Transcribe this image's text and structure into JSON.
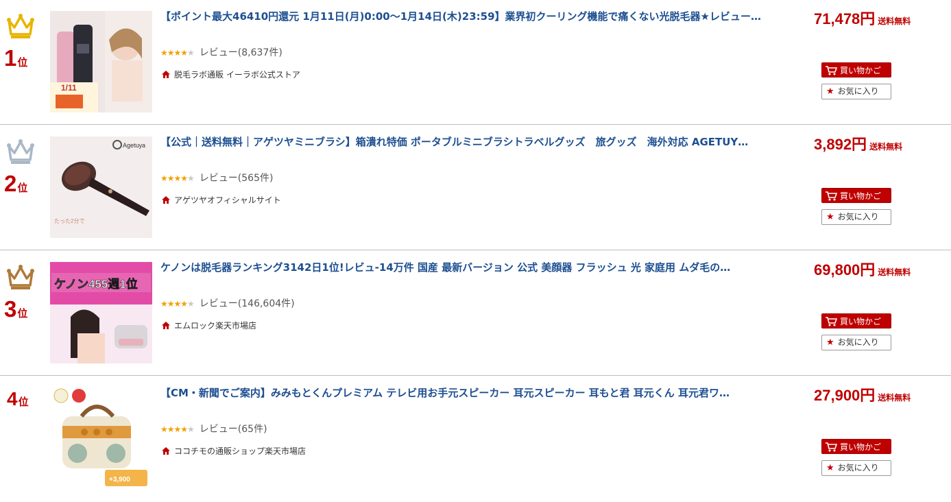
{
  "ranking": [
    {
      "rank_number": "1",
      "rank_suffix": "位",
      "crown": "gold-crown-icon",
      "title": "【ポイント最大46410円還元 1月11日(月)0:00～1月14日(木)23:59】業界初クーリング機能で痛くない光脱毛器★レビュー…",
      "rating_stars": 4,
      "review_text": "レビュー(8,637件)",
      "shop": "脱毛ラボ通販 イーラボ公式ストア",
      "price": "71,478円",
      "shipping": "送料無料",
      "cart_label": "買い物かご",
      "fav_label": "お気に入り",
      "thumb_text": "1/11"
    },
    {
      "rank_number": "2",
      "rank_suffix": "位",
      "crown": "silver-crown-icon",
      "title": "【公式｜送料無料｜アゲツヤミニブラシ】箱潰れ特価 ポータブルミニブラシトラベルグッズ　旅グッズ　海外対応 AGETUY…",
      "rating_stars": 4,
      "review_text": "レビュー(565件)",
      "shop": "アゲツヤオフィシャルサイト",
      "price": "3,892円",
      "shipping": "送料無料",
      "cart_label": "買い物かご",
      "fav_label": "お気に入り",
      "thumb_text": "Agetuya"
    },
    {
      "rank_number": "3",
      "rank_suffix": "位",
      "crown": "bronze-crown-icon",
      "title": "ケノンは脱毛器ランキング3142日1位!レビュ-14万件 国産 最新バージョン 公式 美顔器 フラッシュ 光 家庭用 ムダ毛の…",
      "rating_stars": 4,
      "review_text": "レビュー(146,604件)",
      "shop": "エムロック楽天市場店",
      "price": "69,800円",
      "shipping": "送料無料",
      "cart_label": "買い物かご",
      "fav_label": "お気に入り",
      "thumb_text": "ケノン455週1位"
    },
    {
      "rank_number": "4",
      "rank_suffix": "位",
      "crown": "",
      "title": "【CM・新聞でご案内】みみもとくんプレミアム テレビ用お手元スピーカー 耳元スピーカー 耳もと君 耳元くん 耳元君ワ…",
      "rating_stars": 4,
      "review_text": "レビュー(65件)",
      "shop": "ココチモの通販ショップ楽天市場店",
      "price": "27,900円",
      "shipping": "送料無料",
      "cart_label": "買い物かご",
      "fav_label": "お気に入り",
      "thumb_text": "+3,900"
    }
  ],
  "colors": {
    "accent": "#bf0000",
    "title_link": "#1d4f91",
    "star": "#f2a100",
    "gold": "#e8b400",
    "silver": "#a9b7c6",
    "bronze": "#b07a3a"
  }
}
